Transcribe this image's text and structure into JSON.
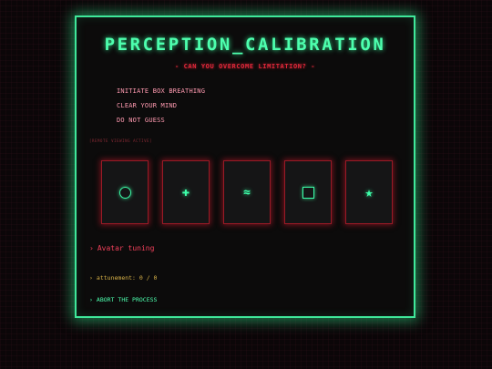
{
  "title": "PERCEPTION_CALIBRATION",
  "subtitle": "- CAN YOU OVERCOME LIMITATION? -",
  "instructions": [
    "INITIATE BOX BREATHING",
    "CLEAR YOUR MIND",
    "DO NOT GUESS"
  ],
  "tiny_note": "[REMOTE VIEWING ACTIVE]",
  "cards": [
    {
      "symbol": "circle",
      "glyph": ""
    },
    {
      "symbol": "plus",
      "glyph": "✚"
    },
    {
      "symbol": "waves",
      "glyph": "≈"
    },
    {
      "symbol": "square",
      "glyph": ""
    },
    {
      "symbol": "star",
      "glyph": "★"
    }
  ],
  "avatar": {
    "chevron": "›",
    "label": "Avatar tuning"
  },
  "attunement": {
    "chevron": "›",
    "label": "attunement: 0 / 0"
  },
  "abort": {
    "chevron": "›",
    "label": "ABORT THE PROCESS"
  },
  "colors": {
    "frame": "#3fe89a",
    "title": "#4dffae",
    "subtitle": "#e0283a",
    "instructions": "#ff9ab0",
    "card_border": "#9a1a26",
    "avatar": "#f0405a",
    "attunement": "#d8b248"
  }
}
